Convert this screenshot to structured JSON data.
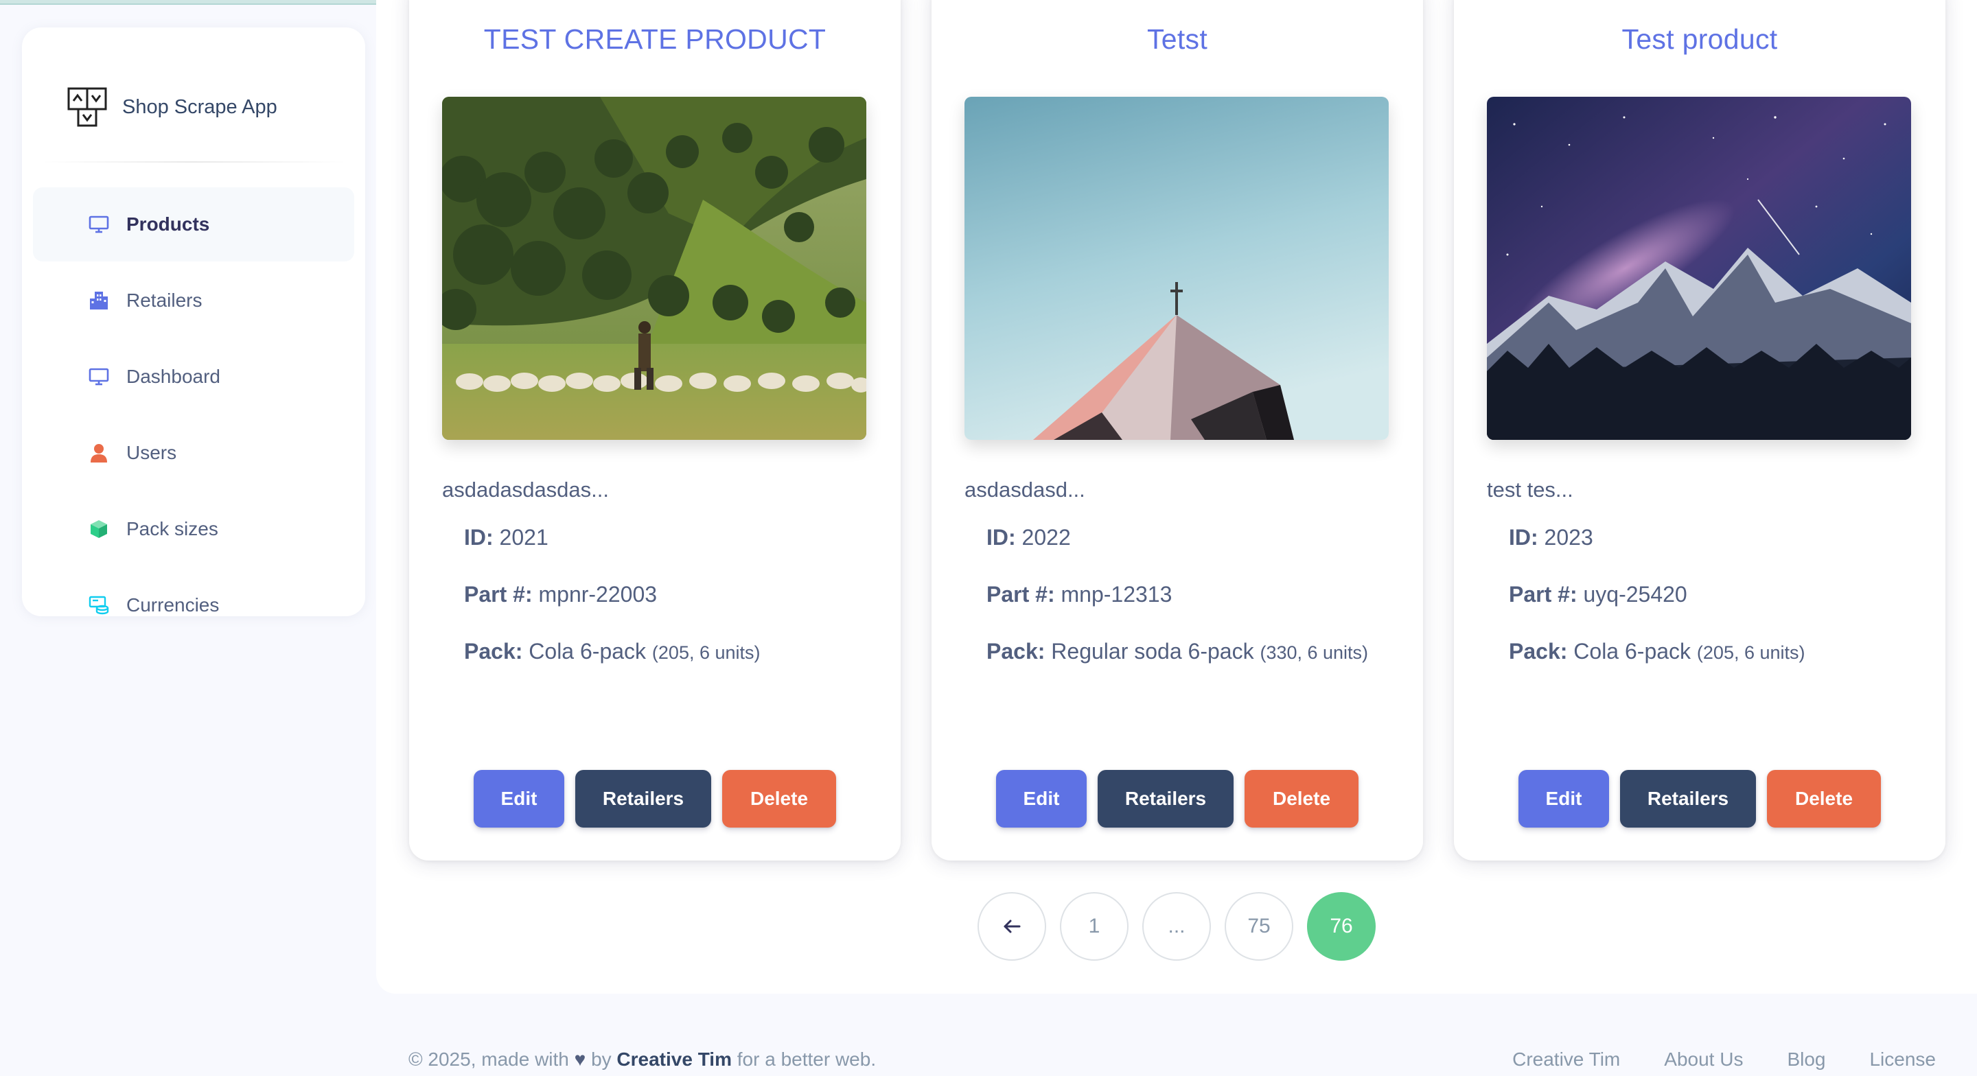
{
  "app": {
    "name": "Shop Scrape App"
  },
  "sidebar": {
    "items": [
      {
        "label": "Products",
        "icon": "monitor-icon",
        "color": "#5e72e4",
        "active": true
      },
      {
        "label": "Retailers",
        "icon": "building-icon",
        "color": "#5e72e4"
      },
      {
        "label": "Dashboard",
        "icon": "monitor-icon",
        "color": "#5e72e4"
      },
      {
        "label": "Users",
        "icon": "user-icon",
        "color": "#ea6b48"
      },
      {
        "label": "Pack sizes",
        "icon": "box-icon",
        "color": "#2dce89"
      },
      {
        "label": "Currencies",
        "icon": "coins-icon",
        "color": "#11cdef"
      }
    ]
  },
  "products": [
    {
      "title": "TEST CREATE PRODUCT",
      "description": "asdadasdasdas...",
      "id_label": "ID:",
      "id": "2021",
      "part_label": "Part #:",
      "part": "mpnr-22003",
      "pack_label": "Pack:",
      "pack": "Cola 6-pack",
      "pack_detail": "(205, 6 units)",
      "image": "meadow-sheep-image"
    },
    {
      "title": "Tetst",
      "description": "asdasdasd...",
      "id_label": "ID:",
      "id": "2022",
      "part_label": "Part #:",
      "part": "mnp-12313",
      "pack_label": "Pack:",
      "pack": "Regular soda 6-pack",
      "pack_detail": "(330, 6 units)",
      "image": "church-roof-sky-image"
    },
    {
      "title": "Test product",
      "description": "test tes...",
      "id_label": "ID:",
      "id": "2023",
      "part_label": "Part #:",
      "part": "uyq-25420",
      "pack_label": "Pack:",
      "pack": "Cola 6-pack",
      "pack_detail": "(205, 6 units)",
      "image": "milky-way-mountains-image"
    }
  ],
  "buttons": {
    "edit": "Edit",
    "retailers": "Retailers",
    "delete": "Delete"
  },
  "pagination": {
    "prev_icon": "arrow-left-icon",
    "pages": [
      "1",
      "...",
      "75",
      "76"
    ],
    "current": "76"
  },
  "footer": {
    "copyright": "© 2025, made with",
    "by": "by",
    "author": "Creative Tim",
    "tagline": "for a better web.",
    "links": [
      "Creative Tim",
      "About Us",
      "Blog",
      "License"
    ]
  },
  "colors": {
    "primary": "#5e72e4",
    "dark": "#344767",
    "danger": "#ea6b48",
    "success": "#5fcf8e"
  }
}
